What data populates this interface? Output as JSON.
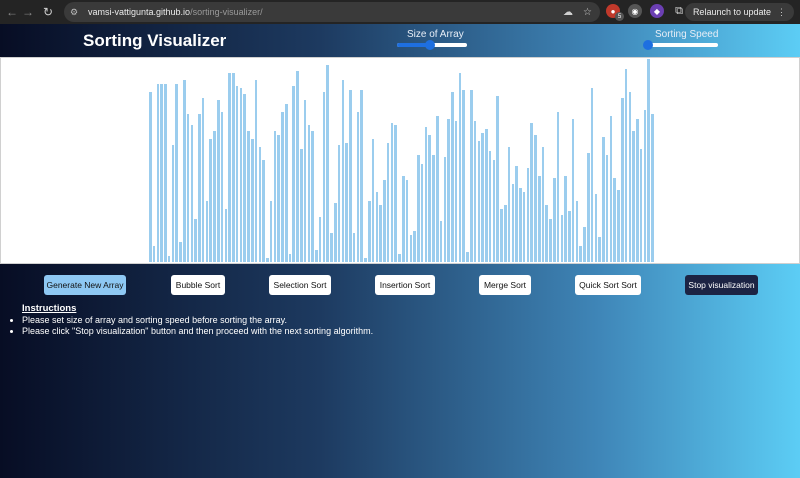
{
  "browser": {
    "url_host": "vamsi-vattigunta.github.io",
    "url_path": "/sorting-visualizer/",
    "ext_badge": "5",
    "relaunch_label": "Relaunch to update",
    "menu_icon": "⋮"
  },
  "header": {
    "title": "Sorting Visualizer",
    "size_label": "Size of Array",
    "speed_label": "Sorting Speed",
    "size_value": 0.47,
    "speed_value": 0.0
  },
  "array": [
    0.83,
    0.08,
    0.87,
    0.87,
    0.87,
    0.03,
    0.57,
    0.87,
    0.1,
    0.89,
    0.72,
    0.67,
    0.21,
    0.72,
    0.8,
    0.3,
    0.6,
    0.64,
    0.79,
    0.73,
    0.26,
    0.92,
    0.92,
    0.86,
    0.85,
    0.82,
    0.64,
    0.6,
    0.89,
    0.56,
    0.5,
    0.02,
    0.3,
    0.64,
    0.62,
    0.73,
    0.77,
    0.04,
    0.86,
    0.93,
    0.55,
    0.79,
    0.67,
    0.64,
    0.06,
    0.22,
    0.83,
    0.96,
    0.14,
    0.29,
    0.57,
    0.89,
    0.58,
    0.84,
    0.14,
    0.73,
    0.84,
    0.02,
    0.3,
    0.6,
    0.34,
    0.28,
    0.4,
    0.58,
    0.68,
    0.67,
    0.04,
    0.42,
    0.4,
    0.13,
    0.15,
    0.52,
    0.48,
    0.66,
    0.62,
    0.52,
    0.71,
    0.2,
    0.51,
    0.7,
    0.83,
    0.69,
    0.92,
    0.84,
    0.05,
    0.84,
    0.69,
    0.59,
    0.63,
    0.65,
    0.54,
    0.5,
    0.81,
    0.26,
    0.28,
    0.56,
    0.38,
    0.47,
    0.36,
    0.34,
    0.46,
    0.68,
    0.62,
    0.42,
    0.56,
    0.28,
    0.21,
    0.41,
    0.73,
    0.23,
    0.42,
    0.25,
    0.7,
    0.3,
    0.08,
    0.17,
    0.53,
    0.85,
    0.33,
    0.12,
    0.61,
    0.52,
    0.71,
    0.41,
    0.35,
    0.8,
    0.94,
    0.83,
    0.64,
    0.7,
    0.55,
    0.74,
    0.99,
    0.72
  ],
  "buttons": {
    "generate": "Generate New Array",
    "bubble": "Bubble Sort",
    "selection": "Selection Sort",
    "insertion": "Insertion Sort",
    "merge": "Merge Sort",
    "quick": "Quick Sort Sort",
    "stop": "Stop visualization"
  },
  "instructions": {
    "heading": "Instructions",
    "items": [
      "Please set size of array and sorting speed before sorting the array.",
      "Please click \"Stop visualization\" button and then proceed with the next sorting algorithm."
    ]
  }
}
